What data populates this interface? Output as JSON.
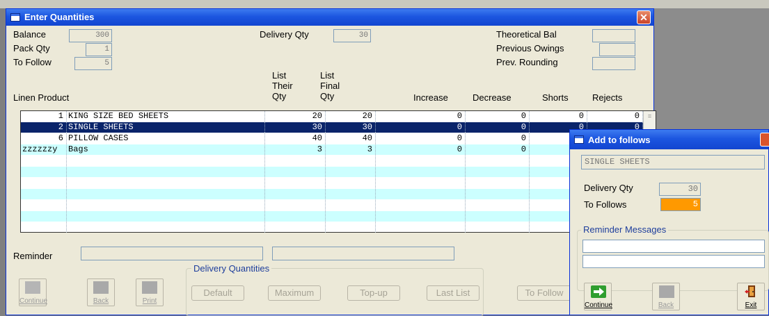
{
  "main": {
    "title": "Enter Quantities",
    "close_glyph": "✕",
    "fields": {
      "balance_label": "Balance",
      "balance_value": "300",
      "pack_qty_label": "Pack Qty",
      "pack_qty_value": "1",
      "to_follow_label": "To Follow",
      "to_follow_value": "5",
      "delivery_qty_label": "Delivery Qty",
      "delivery_qty_value": "30",
      "theoretical_bal_label": "Theoretical Bal",
      "theoretical_bal_value": "",
      "previous_owings_label": "Previous Owings",
      "previous_owings_value": "",
      "prev_rounding_label": "Prev. Rounding",
      "prev_rounding_value": ""
    },
    "columns": {
      "linen_product": "Linen Product",
      "their_qty_1": "List",
      "their_qty_2": "Their",
      "their_qty_3": "Qty",
      "final_qty_1": "List",
      "final_qty_2": "Final",
      "final_qty_3": "Qty",
      "increase": "Increase",
      "decrease": "Decrease",
      "shorts": "Shorts",
      "rejects": "Rejects"
    },
    "rows": [
      {
        "code": "1",
        "product": "KING SIZE BED SHEETS",
        "their_qty": "20",
        "final_qty": "20",
        "increase": "0",
        "decrease": "0",
        "shorts": "0",
        "rejects": "0"
      },
      {
        "code": "2",
        "product": "SINGLE SHEETS",
        "their_qty": "30",
        "final_qty": "30",
        "increase": "0",
        "decrease": "0",
        "shorts": "0",
        "rejects": "0"
      },
      {
        "code": "6",
        "product": "PILLOW CASES",
        "their_qty": "40",
        "final_qty": "40",
        "increase": "0",
        "decrease": "0",
        "shorts": "",
        "rejects": ""
      },
      {
        "code": "zzzzzzy",
        "product": "Bags",
        "their_qty": "3",
        "final_qty": "3",
        "increase": "0",
        "decrease": "0",
        "shorts": "",
        "rejects": ""
      }
    ],
    "scroll_glyph": "=",
    "reminder_label": "Reminder",
    "reminder_value_1": "",
    "reminder_value_2": "",
    "delivery_group_label": "Delivery Quantities",
    "buttons": {
      "continue": "Continue",
      "back": "Back",
      "print": "Print",
      "default": "Default",
      "maximum": "Maximum",
      "topup": "Top-up",
      "last_list": "Last List",
      "to_follow": "To Follow"
    }
  },
  "popup": {
    "title": "Add to follows",
    "product": "SINGLE SHEETS",
    "delivery_qty_label": "Delivery Qty",
    "delivery_qty_value": "30",
    "to_follows_label": "To Follows",
    "to_follows_value": "5",
    "reminder_messages_label": "Reminder Messages",
    "reminder_message_1": "",
    "reminder_message_2": "",
    "buttons": {
      "continue": "Continue",
      "back": "Back",
      "exit": "Exit"
    }
  },
  "colors": {
    "selected_row": "#0a246a",
    "alt_row": "#ccffff",
    "title_blue": "#1c56e0",
    "highlight_field": "#ff9900"
  }
}
